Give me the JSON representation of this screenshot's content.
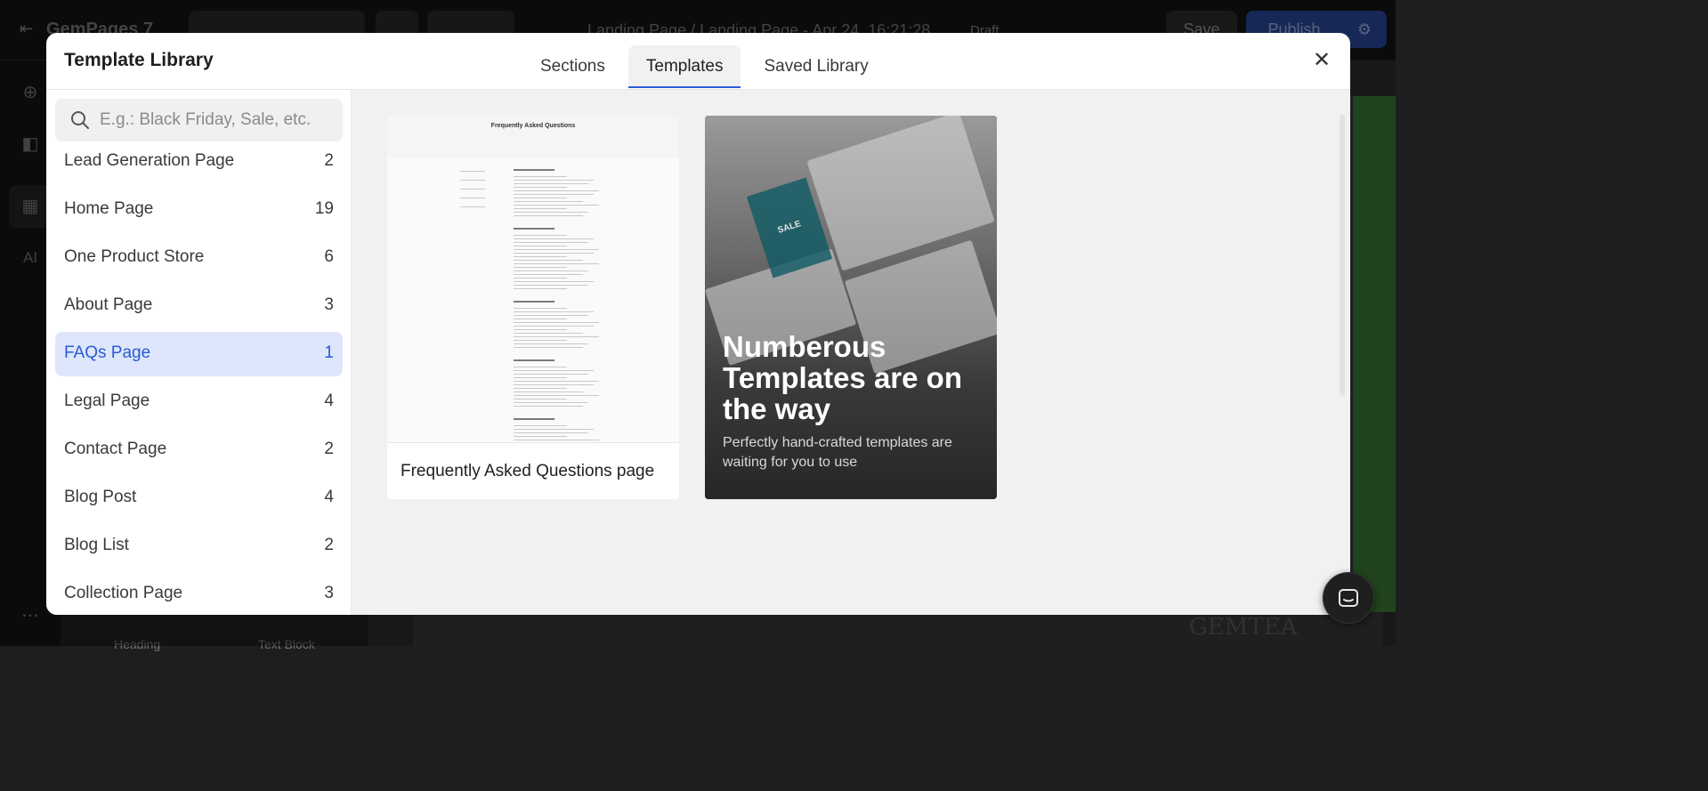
{
  "editor": {
    "logo": "GemPages 7",
    "breadcrumb": "Landing Page  /  Landing Page - Apr 24, 16:21:28",
    "status_badge": "Draft",
    "save_label": "Save",
    "publish_label": "Publish",
    "bottom_left_labels": [
      "Heading",
      "Text Block"
    ],
    "canvas_brand": "GEMTEA"
  },
  "modal": {
    "title": "Template Library",
    "tabs": [
      {
        "label": "Sections",
        "active": false
      },
      {
        "label": "Templates",
        "active": true
      },
      {
        "label": "Saved Library",
        "active": false
      }
    ]
  },
  "search": {
    "placeholder": "E.g.: Black Friday, Sale, etc.",
    "value": ""
  },
  "categories": [
    {
      "label": "Lead Generation Page",
      "count": "2",
      "selected": false
    },
    {
      "label": "Home Page",
      "count": "19",
      "selected": false
    },
    {
      "label": "One Product Store",
      "count": "6",
      "selected": false
    },
    {
      "label": "About Page",
      "count": "3",
      "selected": false
    },
    {
      "label": "FAQs Page",
      "count": "1",
      "selected": true
    },
    {
      "label": "Legal Page",
      "count": "4",
      "selected": false
    },
    {
      "label": "Contact Page",
      "count": "2",
      "selected": false
    },
    {
      "label": "Blog Post",
      "count": "4",
      "selected": false
    },
    {
      "label": "Blog List",
      "count": "2",
      "selected": false
    },
    {
      "label": "Collection Page",
      "count": "3",
      "selected": false
    }
  ],
  "templates": [
    {
      "label": "Frequently Asked Questions page",
      "preview_title": "Frequently Asked Questions"
    }
  ],
  "promo": {
    "title": "Numberous Templates are on the way",
    "subtitle": "Perfectly hand-crafted templates are waiting for you to use",
    "sale_tag": "SALE"
  },
  "colors": {
    "accent": "#2a5bd7",
    "selected_bg": "#dde6fb"
  }
}
